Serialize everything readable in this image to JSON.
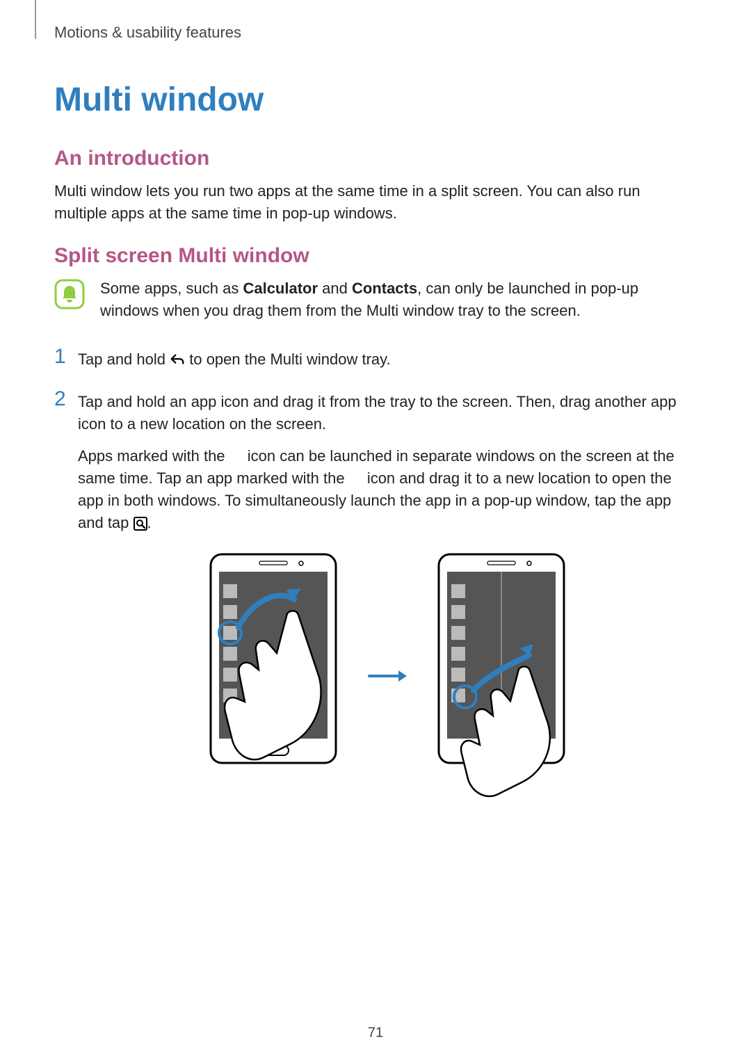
{
  "breadcrumb": "Motions & usability features",
  "title": "Multi window",
  "intro": {
    "heading": "An introduction",
    "body": "Multi window lets you run two apps at the same time in a split screen. You can also run multiple apps at the same time in pop-up windows."
  },
  "split": {
    "heading": "Split screen Multi window",
    "note_pre": "Some apps, such as ",
    "note_bold1": "Calculator",
    "note_mid": " and ",
    "note_bold2": "Contacts",
    "note_post": ", can only be launched in pop-up windows when you drag them from the Multi window tray to the screen.",
    "steps": {
      "s1_num": "1",
      "s1_pre": "Tap and hold ",
      "s1_post": " to open the Multi window tray.",
      "s2_num": "2",
      "s2_p1": "Tap and hold an app icon and drag it from the tray to the screen. Then, drag another app icon to a new location on the screen.",
      "s2_p2_a": "Apps marked with the ",
      "s2_p2_b": " icon can be launched in separate windows on the screen at the same time. Tap an app marked with the ",
      "s2_p2_c": " icon and drag it to a new location to open the app in both windows. To simultaneously launch the app in a pop-up window, tap the app and tap ",
      "s2_p2_d": "."
    }
  },
  "page_number": "71",
  "colors": {
    "accent_blue": "#2f7fbf",
    "accent_pink": "#b55785",
    "note_green": "#8fce3e"
  }
}
